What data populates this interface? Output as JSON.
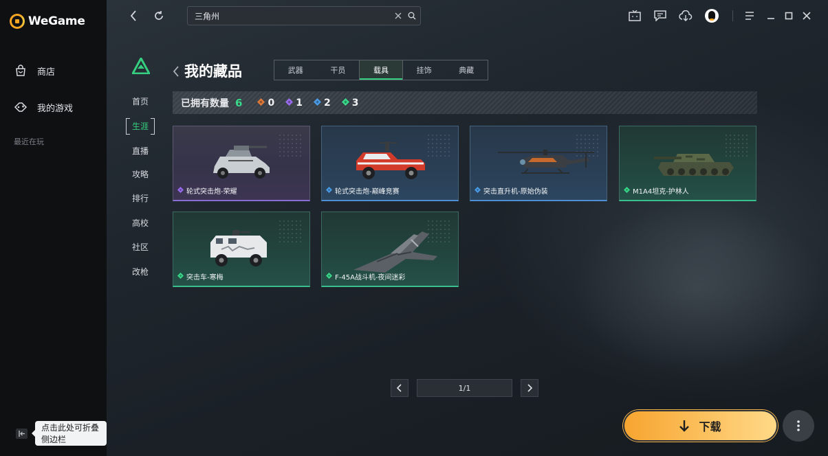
{
  "app": {
    "brand": "WeGame",
    "nav": [
      {
        "label": "商店",
        "icon": "bag-icon"
      },
      {
        "label": "我的游戏",
        "icon": "gamepad-icon"
      }
    ],
    "recent_label": "最近在玩",
    "collapse_tooltip": "点击此处可折叠侧边栏"
  },
  "search": {
    "value": "三角州",
    "placeholder": ""
  },
  "game_nav": [
    "首页",
    "生涯",
    "直播",
    "攻略",
    "排行",
    "高校",
    "社区",
    "改枪"
  ],
  "game_nav_active": "生涯",
  "page": {
    "title": "我的藏品",
    "tabs": [
      "武器",
      "干员",
      "载具",
      "挂饰",
      "典藏"
    ],
    "active_tab": "载具"
  },
  "summary": {
    "label": "已拥有数量",
    "total": "6",
    "stats": [
      {
        "value": "0",
        "color": "#e07a3a"
      },
      {
        "value": "1",
        "color": "#9a6cf0"
      },
      {
        "value": "2",
        "color": "#4a9be8"
      },
      {
        "value": "3",
        "color": "#39d98a"
      }
    ]
  },
  "items": [
    {
      "name": "轮式突击炮-荣耀",
      "rarity": "purple",
      "icon": "armored-car-icon"
    },
    {
      "name": "轮式突击炮-巅峰竞赛",
      "rarity": "blue",
      "icon": "pickup-truck-icon"
    },
    {
      "name": "突击直升机-原始伪装",
      "rarity": "blue",
      "icon": "helicopter-icon"
    },
    {
      "name": "M1A4坦克-护林人",
      "rarity": "green",
      "icon": "tank-icon"
    },
    {
      "name": "突击车-寒梅",
      "rarity": "green",
      "icon": "assault-vehicle-icon"
    },
    {
      "name": "F-45A战斗机-夜间迷彩",
      "rarity": "green",
      "icon": "fighter-jet-icon"
    }
  ],
  "pagination": "1/1",
  "download_label": "下载",
  "colors": {
    "accent_green": "#35d07f",
    "download_orange": "#f7a530",
    "purple": "#8a6cd6",
    "blue": "#4f8fd6",
    "green": "#39c08e"
  }
}
